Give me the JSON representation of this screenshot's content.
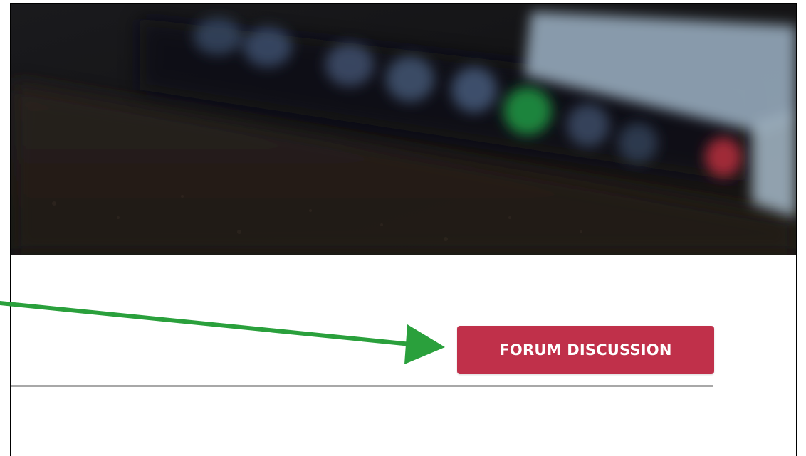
{
  "forum_button": {
    "label": "FORUM DISCUSSION"
  },
  "colors": {
    "button_bg": "#c0304a",
    "button_text": "#ffffff",
    "divider": "#a8a8a8",
    "annotation_arrow": "#2aa03c"
  },
  "icons": {
    "annotation": "arrow-pointer-icon"
  }
}
